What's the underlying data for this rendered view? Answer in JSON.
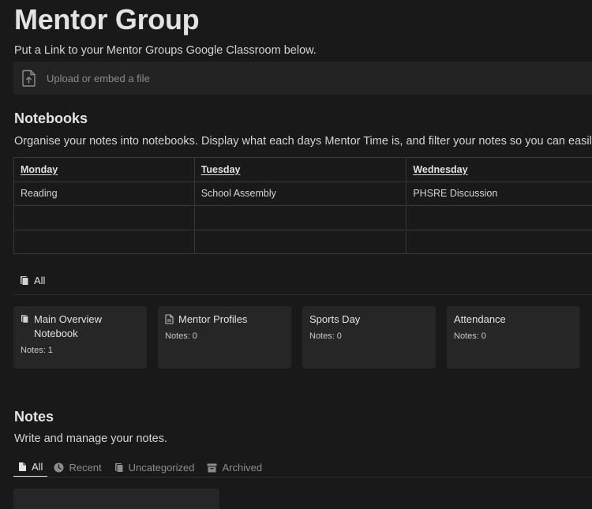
{
  "page": {
    "title": "Mentor Group",
    "intro": "Put a Link to your Mentor Groups Google Classroom below."
  },
  "upload": {
    "icon": "upload-file-icon",
    "label": "Upload or embed a file"
  },
  "notebooks": {
    "title": "Notebooks",
    "description": "Organise your notes into notebooks. Display what each days Mentor Time is, and filter your notes so you can easily fi",
    "table": {
      "headers": [
        "Monday",
        "Tuesday",
        "Wednesday"
      ],
      "rows": [
        [
          "Reading",
          "School Assembly",
          "PHSRE Discussion"
        ],
        [
          "",
          "",
          ""
        ],
        [
          "",
          "",
          ""
        ]
      ]
    },
    "view_tab": {
      "label": "All",
      "icon": "notebook-icon"
    },
    "count_label": "Notes:",
    "cards": [
      {
        "title": "Main Overview Notebook",
        "icon": "notebook-icon",
        "count": "1"
      },
      {
        "title": "Mentor Profiles",
        "icon": "page-icon",
        "count": "0"
      },
      {
        "title": "Sports Day",
        "icon": "",
        "count": "0"
      },
      {
        "title": "Attendance",
        "icon": "",
        "count": "0"
      }
    ]
  },
  "notes": {
    "title": "Notes",
    "description": "Write and manage your notes.",
    "tabs": [
      {
        "label": "All",
        "icon": "document-icon",
        "active": true
      },
      {
        "label": "Recent",
        "icon": "clock-icon",
        "active": false
      },
      {
        "label": "Uncategorized",
        "icon": "notebooks-icon",
        "active": false
      },
      {
        "label": "Archived",
        "icon": "archive-box-icon",
        "active": false
      }
    ]
  },
  "colors": {
    "background": "#191919",
    "surface": "#262626",
    "border": "#373737",
    "text": "#d4d4d4",
    "muted": "#8c8c8c"
  }
}
